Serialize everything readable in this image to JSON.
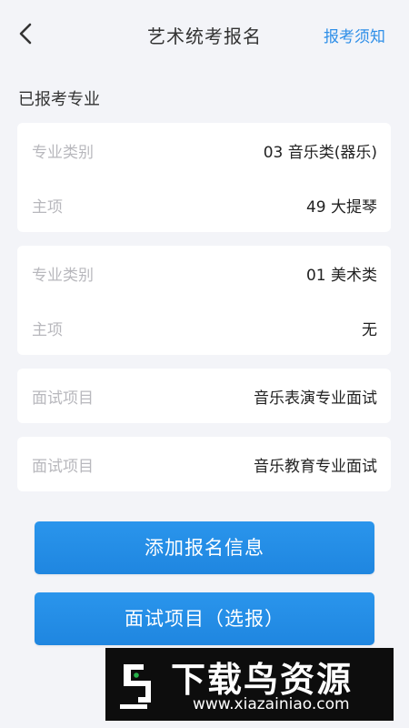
{
  "header": {
    "title": "艺术统考报名",
    "notice_link": "报考须知",
    "back_icon": "chevron-left-icon"
  },
  "section": {
    "title": "已报考专业"
  },
  "majors": [
    {
      "rows": [
        {
          "label": "专业类别",
          "value": "03 音乐类(器乐)"
        },
        {
          "label": "主项",
          "value": "49 大提琴"
        }
      ]
    },
    {
      "rows": [
        {
          "label": "专业类别",
          "value": "01 美术类"
        },
        {
          "label": "主项",
          "value": "无"
        }
      ]
    }
  ],
  "interviews": [
    {
      "label": "面试项目",
      "value": "音乐表演专业面试"
    },
    {
      "label": "面试项目",
      "value": "音乐教育专业面试"
    }
  ],
  "buttons": {
    "add_label": "添加报名信息",
    "interview_label": "面试项目（选报）"
  },
  "watermark": {
    "title": "下载鸟资源",
    "url": "www.xiazainiao.com"
  },
  "colors": {
    "accent": "#2f8fe8",
    "button": "#2490e8",
    "background": "#f3f4f8",
    "label": "#b8b8bd"
  }
}
